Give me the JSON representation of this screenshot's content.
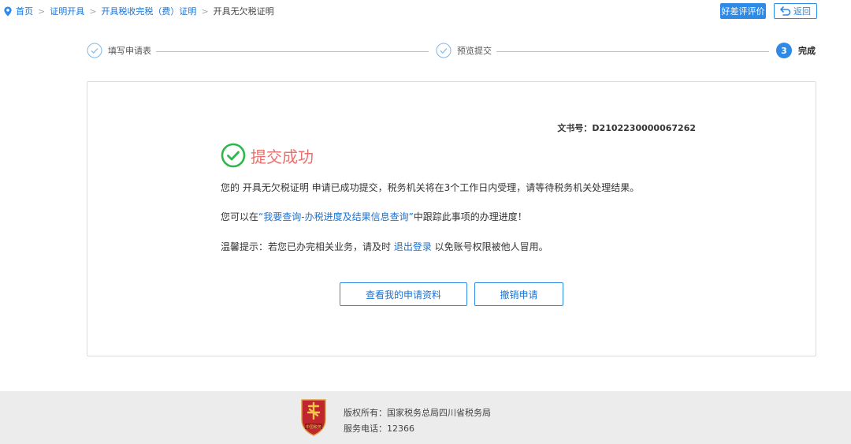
{
  "breadcrumb": {
    "home": "首页",
    "separator": ">",
    "level1": "证明开具",
    "level2": "开具税收完税（费）证明",
    "current": "开具无欠税证明"
  },
  "header": {
    "rate_button": "好差评评价",
    "back_button": "返回"
  },
  "steps": [
    {
      "label": "填写申请表",
      "state": "completed"
    },
    {
      "label": "预览提交",
      "state": "completed"
    },
    {
      "label": "完成",
      "number": "3",
      "state": "active"
    }
  ],
  "result": {
    "doc_number": "文书号：D2102230000067262",
    "title": "提交成功",
    "line1": "您的 开具无欠税证明 申请已成功提交，税务机关将在3个工作日内受理，请等待税务机关处理结果。",
    "line2_prefix": "您可以在",
    "line2_link": "“我要查询-办税进度及结果信息查询”",
    "line2_suffix": "中跟踪此事项的办理进度！",
    "line3_prefix": "温馨提示：若您已办完相关业务，请及时 ",
    "line3_link": "退出登录",
    "line3_suffix": " 以免账号权限被他人冒用。"
  },
  "actions": {
    "view_button": "查看我的申请资料",
    "cancel_button": "撤销申请"
  },
  "footer": {
    "copyright": "版权所有：国家税务总局四川省税务局",
    "phone": "服务电话：12366",
    "emblem_caption": "中国税务"
  },
  "colors": {
    "primary": "#2f8ae6",
    "link": "#1a73d4",
    "success_green": "#2db84d",
    "success_title": "#e8706d",
    "footer_bg": "#ececec"
  }
}
